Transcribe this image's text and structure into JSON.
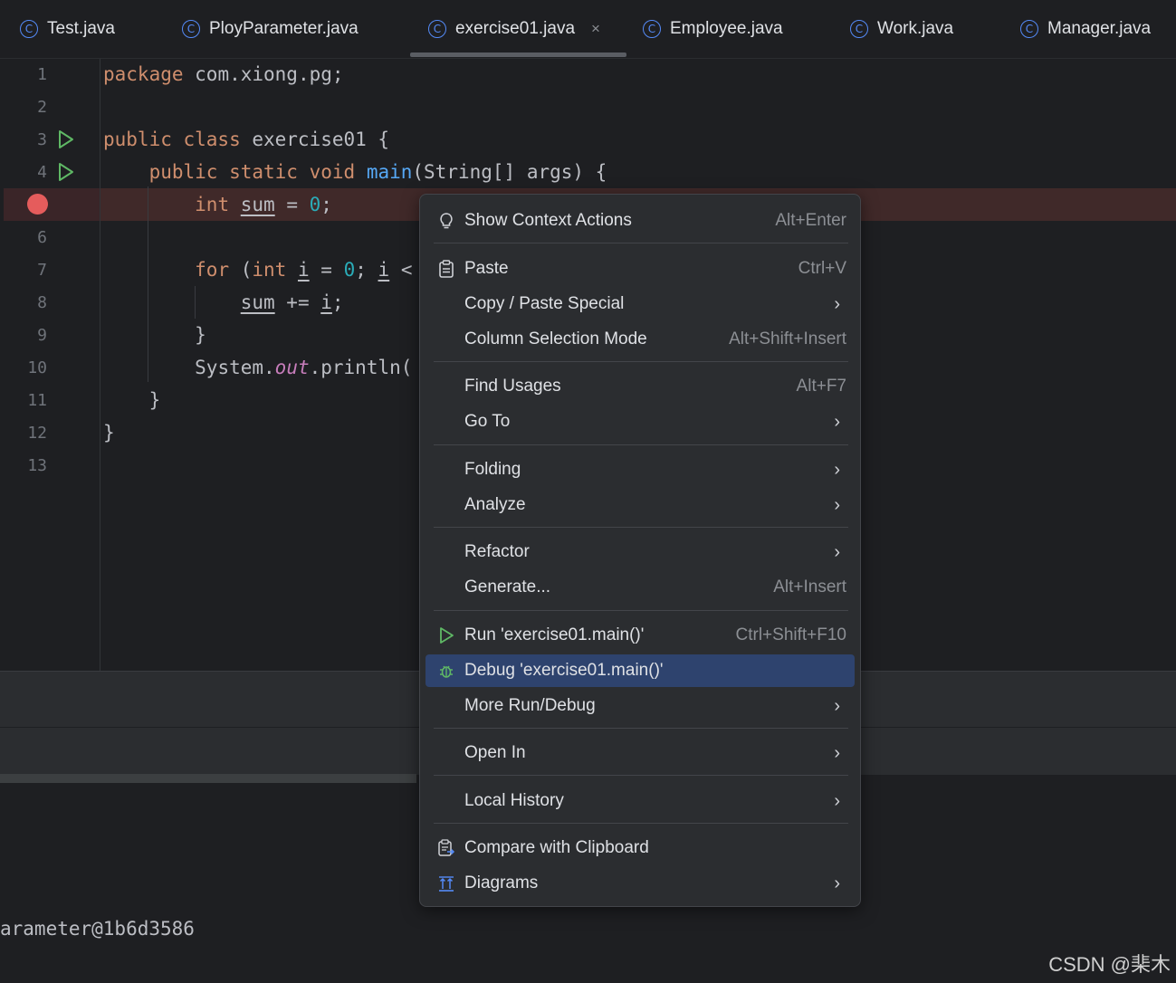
{
  "tabs": [
    {
      "label": "Test.java"
    },
    {
      "label": "PloyParameter.java"
    },
    {
      "label": "exercise01.java",
      "close": "×"
    },
    {
      "label": "Employee.java"
    },
    {
      "label": "Work.java"
    },
    {
      "label": "Manager.java"
    }
  ],
  "line_numbers": [
    "1",
    "2",
    "3",
    "4",
    "6",
    "7",
    "8",
    "9",
    "10",
    "11",
    "12",
    "13"
  ],
  "code": {
    "l1_kw": "package",
    "l1_rest": " com.xiong.pg;",
    "l3_kw": "public class",
    "l3_rest": " exercise01 {",
    "l4_kw": "public static void",
    "l4_fn": "main",
    "l4_rest": "(String[] args) {",
    "l5_kw": "int",
    "l5_var": "sum",
    "l5_eq": " = ",
    "l5_num": "0",
    "l5_end": ";",
    "l7_kw": "for",
    "l7_a": " (",
    "l7_kw2": "int",
    "l7_var": "i",
    "l7_eq": " = ",
    "l7_num": "0",
    "l7_semi": "; ",
    "l7_var2": "i",
    "l7_lt": " <",
    "l8_var": "sum",
    "l8_op": " += ",
    "l8_var2": "i",
    "l8_end": ";",
    "l9": "}",
    "l10_a": "System.",
    "l10_st": "out",
    "l10_b": ".println(",
    "l11": "}",
    "l12": "}"
  },
  "console": {
    "text": "arameter@1b6d3586"
  },
  "watermark": "CSDN @棐木",
  "menu": {
    "items": [
      {
        "label": "Show Context Actions",
        "shortcut": "Alt+Enter",
        "icon": "lightbulb-icon"
      },
      {
        "label": "Paste",
        "shortcut": "Ctrl+V",
        "icon": "clipboard-icon"
      },
      {
        "label": "Copy / Paste Special",
        "arrow": "›"
      },
      {
        "label": "Column Selection Mode",
        "shortcut": "Alt+Shift+Insert"
      },
      {
        "label": "Find Usages",
        "shortcut": "Alt+F7"
      },
      {
        "label": "Go To",
        "arrow": "›"
      },
      {
        "label": "Folding",
        "arrow": "›"
      },
      {
        "label": "Analyze",
        "arrow": "›"
      },
      {
        "label": "Refactor",
        "arrow": "›"
      },
      {
        "label": "Generate...",
        "shortcut": "Alt+Insert"
      },
      {
        "label": "Run 'exercise01.main()'",
        "shortcut": "Ctrl+Shift+F10",
        "icon": "run-icon"
      },
      {
        "label": "Debug 'exercise01.main()'",
        "icon": "bug-icon",
        "selected": true
      },
      {
        "label": "More Run/Debug",
        "arrow": "›"
      },
      {
        "label": "Open In",
        "arrow": "›"
      },
      {
        "label": "Local History",
        "arrow": "›"
      },
      {
        "label": "Compare with Clipboard",
        "icon": "compare-clipboard-icon"
      },
      {
        "label": "Diagrams",
        "arrow": "›",
        "icon": "diagram-icon"
      }
    ]
  },
  "colors": {
    "accent": "#548af7",
    "selection": "#2e436e",
    "breakpoint": "#e55c5c",
    "run": "#5fb865"
  }
}
